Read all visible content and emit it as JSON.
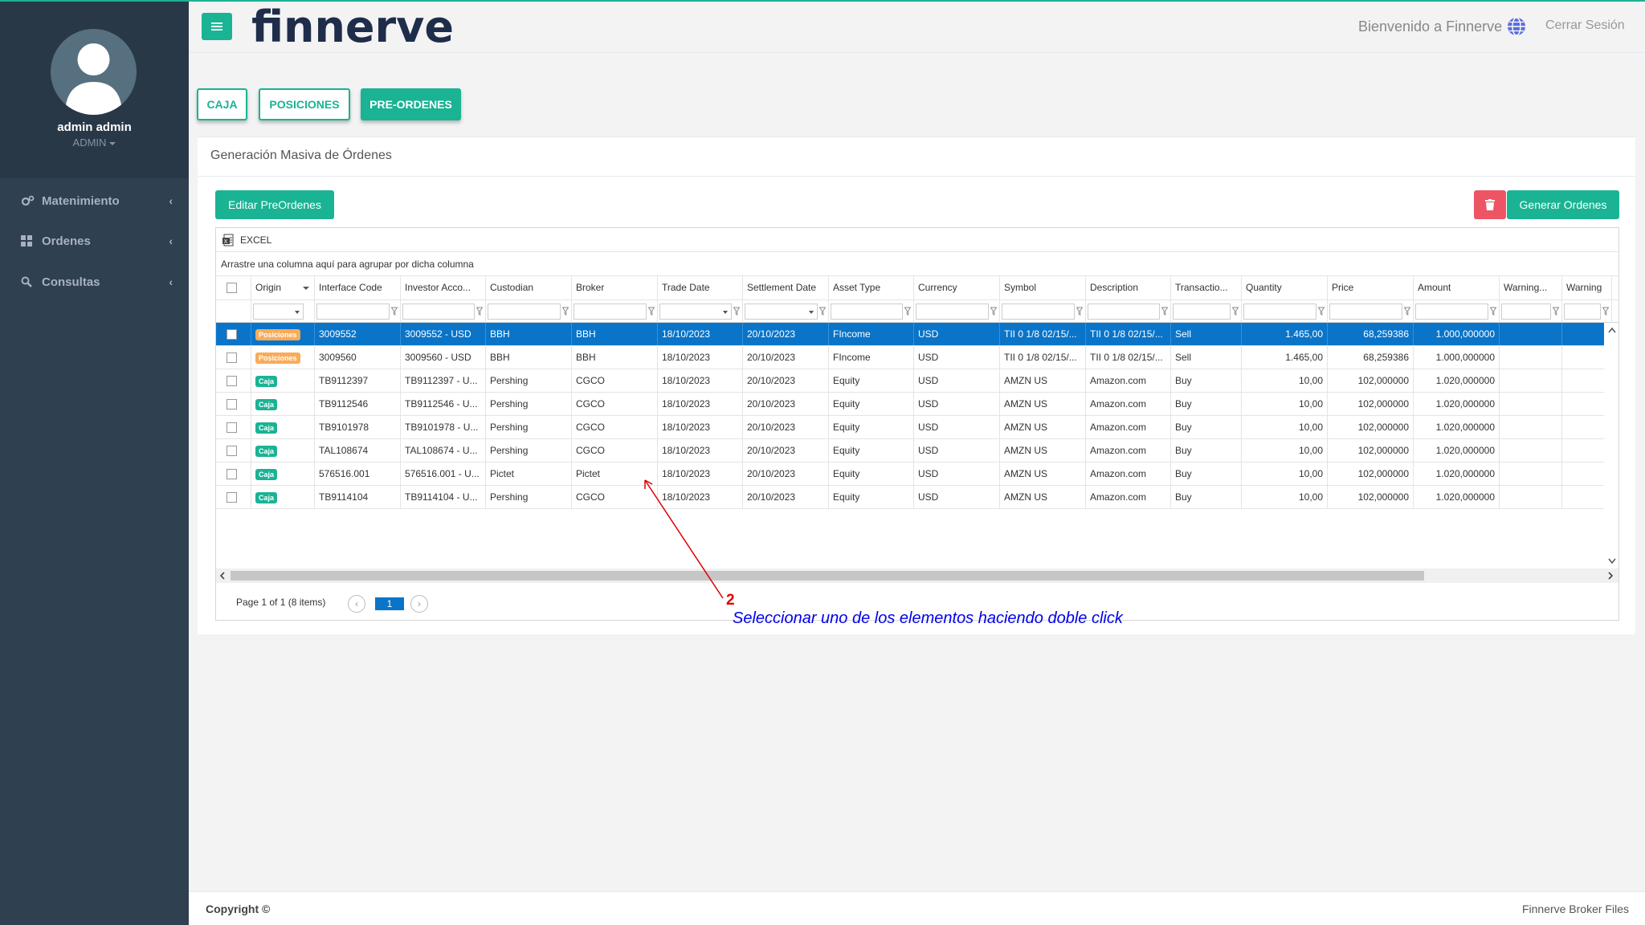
{
  "app": {
    "brand": "finnerve"
  },
  "header": {
    "welcome": "Bienvenido a Finnerve",
    "logout": "Cerrar Sesión"
  },
  "profile": {
    "name": "admin admin",
    "role": "ADMIN"
  },
  "sidebar": {
    "items": [
      {
        "label": "Matenimiento",
        "icon": "cogs-icon"
      },
      {
        "label": "Ordenes",
        "icon": "grid-icon"
      },
      {
        "label": "Consultas",
        "icon": "search-icon"
      }
    ]
  },
  "tabs": [
    {
      "label": "CAJA"
    },
    {
      "label": "POSICIONES"
    },
    {
      "label": "PRE-ORDENES",
      "active": true
    }
  ],
  "panel": {
    "title": "Generación Masiva de Órdenes",
    "edit_label": "Editar PreOrdenes",
    "generate_label": "Generar Ordenes"
  },
  "grid": {
    "excel_label": "EXCEL",
    "group_hint": "Arrastre una columna aquí para agrupar por dicha columna",
    "columns": [
      "Origin",
      "Interface Code",
      "Investor Acco...",
      "Custodian",
      "Broker",
      "Trade Date",
      "Settlement Date",
      "Asset Type",
      "Currency",
      "Symbol",
      "Description",
      "Transactio...",
      "Quantity",
      "Price",
      "Amount",
      "Warning...",
      "Warning"
    ],
    "rows": [
      {
        "origin": "Posiciones",
        "interface": "3009552",
        "investor": "3009552 - USD",
        "custodian": "BBH",
        "broker": "BBH",
        "trade": "18/10/2023",
        "settle": "20/10/2023",
        "asset": "FIncome",
        "currency": "USD",
        "symbol": "TII 0 1/8 02/15/...",
        "description": "TII 0 1/8 02/15/...",
        "transaction": "Sell",
        "quantity": "1.465,00",
        "price": "68,259386",
        "amount": "1.000,000000",
        "selected": true
      },
      {
        "origin": "Posiciones",
        "interface": "3009560",
        "investor": "3009560 - USD",
        "custodian": "BBH",
        "broker": "BBH",
        "trade": "18/10/2023",
        "settle": "20/10/2023",
        "asset": "FIncome",
        "currency": "USD",
        "symbol": "TII 0 1/8 02/15/...",
        "description": "TII 0 1/8 02/15/...",
        "transaction": "Sell",
        "quantity": "1.465,00",
        "price": "68,259386",
        "amount": "1.000,000000"
      },
      {
        "origin": "Caja",
        "interface": "TB9112397",
        "investor": "TB9112397 - U...",
        "custodian": "Pershing",
        "broker": "CGCO",
        "trade": "18/10/2023",
        "settle": "20/10/2023",
        "asset": "Equity",
        "currency": "USD",
        "symbol": "AMZN US",
        "description": "Amazon.com",
        "transaction": "Buy",
        "quantity": "10,00",
        "price": "102,000000",
        "amount": "1.020,000000"
      },
      {
        "origin": "Caja",
        "interface": "TB9112546",
        "investor": "TB9112546 - U...",
        "custodian": "Pershing",
        "broker": "CGCO",
        "trade": "18/10/2023",
        "settle": "20/10/2023",
        "asset": "Equity",
        "currency": "USD",
        "symbol": "AMZN US",
        "description": "Amazon.com",
        "transaction": "Buy",
        "quantity": "10,00",
        "price": "102,000000",
        "amount": "1.020,000000"
      },
      {
        "origin": "Caja",
        "interface": "TB9101978",
        "investor": "TB9101978 - U...",
        "custodian": "Pershing",
        "broker": "CGCO",
        "trade": "18/10/2023",
        "settle": "20/10/2023",
        "asset": "Equity",
        "currency": "USD",
        "symbol": "AMZN US",
        "description": "Amazon.com",
        "transaction": "Buy",
        "quantity": "10,00",
        "price": "102,000000",
        "amount": "1.020,000000"
      },
      {
        "origin": "Caja",
        "interface": "TAL108674",
        "investor": "TAL108674 - U...",
        "custodian": "Pershing",
        "broker": "CGCO",
        "trade": "18/10/2023",
        "settle": "20/10/2023",
        "asset": "Equity",
        "currency": "USD",
        "symbol": "AMZN US",
        "description": "Amazon.com",
        "transaction": "Buy",
        "quantity": "10,00",
        "price": "102,000000",
        "amount": "1.020,000000"
      },
      {
        "origin": "Caja",
        "interface": "576516.001",
        "investor": "576516.001 - U...",
        "custodian": "Pictet",
        "broker": "Pictet",
        "trade": "18/10/2023",
        "settle": "20/10/2023",
        "asset": "Equity",
        "currency": "USD",
        "symbol": "AMZN US",
        "description": "Amazon.com",
        "transaction": "Buy",
        "quantity": "10,00",
        "price": "102,000000",
        "amount": "1.020,000000"
      },
      {
        "origin": "Caja",
        "interface": "TB9114104",
        "investor": "TB9114104 - U...",
        "custodian": "Pershing",
        "broker": "CGCO",
        "trade": "18/10/2023",
        "settle": "20/10/2023",
        "asset": "Equity",
        "currency": "USD",
        "symbol": "AMZN US",
        "description": "Amazon.com",
        "transaction": "Buy",
        "quantity": "10,00",
        "price": "102,000000",
        "amount": "1.020,000000"
      }
    ],
    "pager": {
      "info": "Page 1 of 1 (8 items)",
      "current": "1"
    }
  },
  "annotation": {
    "number": "2",
    "text": "Seleccionar uno de los elementos haciendo doble click"
  },
  "footer": {
    "left": "Copyright ©",
    "right": "Finnerve Broker Files"
  },
  "colors": {
    "primary": "#1ab394",
    "sidebar": "#2f4050",
    "danger": "#ed5565",
    "selection": "#0a74c9",
    "badge_posiciones": "#f8ac59"
  }
}
